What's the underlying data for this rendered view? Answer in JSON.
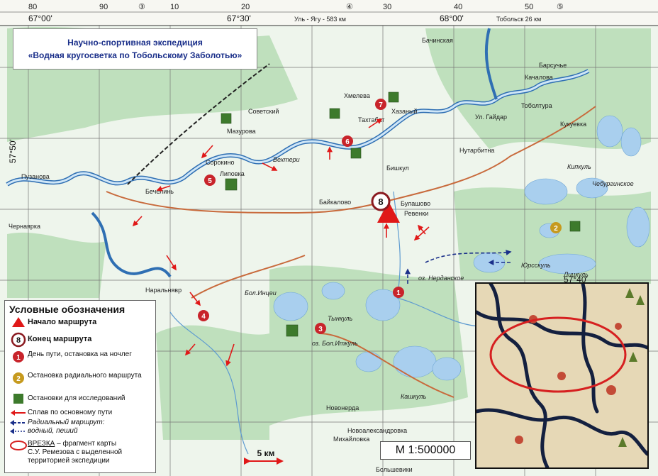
{
  "title": {
    "line1": "Научно-спортивная экспедиция",
    "line2": "«Водная кругосветка по Тобольскому  Заболотью»"
  },
  "top_coords": [
    "67°00'",
    "67°30'",
    "68°00'"
  ],
  "top_grid_numbers": [
    "80",
    "90",
    "③",
    "10",
    "20",
    "④",
    "30",
    "40",
    "50",
    "⑤"
  ],
  "top_road_labels": [
    "Уль - Ягу - 583 км",
    "Тобольск 26 км"
  ],
  "left_coord": "57°50'",
  "right_coord": "57°40'",
  "stage_numbers": [
    "1",
    "2",
    "3",
    "4",
    "5",
    "6",
    "7"
  ],
  "end_stage": "8",
  "place_names": [
    "Хмелева",
    "Хазаный",
    "Тахтабат",
    "Мазурова",
    "Советский",
    "Вехтери",
    "Сорокино",
    "Липовка",
    "Бечелинь",
    "Байкалово",
    "Булашово",
    "Ревенки",
    "Пузанова",
    "Чернаярка",
    "Наральнявр",
    "Новонерда",
    "Новоалександровка",
    "Михайловка",
    "Большевики",
    "Бол.Инцеи",
    "Тынкуль",
    "оз. Бол.Иткуль",
    "Кашкуль",
    "оз. Нерданское",
    "Юрсскуль",
    "Лицкуль",
    "Кипкуль",
    "Чебургинское",
    "Кукуевка",
    "Тоболтура",
    "Нутарбитна",
    "Бишкул",
    "Качалова",
    "Барсучье",
    "Бачинская",
    "Ул. Гайдар"
  ],
  "legend": {
    "title": "Условные обозначения",
    "start": "Начало маршрута",
    "end": "Конец маршрута",
    "end_num": "8",
    "day": "День пути, остановка на ночлег",
    "day_num": "1",
    "radial_stop": "Остановка радиального маршрута",
    "radial_num": "2",
    "research": "Остановки для исследований",
    "rafting": "Сплав по основному пути",
    "radial_route": "Радиальный маршрут:",
    "radial_types": "водный, пеший",
    "inset_word": "ВРЕЗКА",
    "inset_text_1": " – фрагмент карты",
    "inset_text_2": "С.У. Ремезова с выделенной",
    "inset_text_3": "территорией экспедиции"
  },
  "scale": "М 1:500000",
  "scalebar_label": "5 км",
  "colors": {
    "water": "#9ec6e6",
    "lake": "#a9cfee",
    "forest": "#b8dcb8",
    "route": "#e01818",
    "stage": "#c8242b",
    "radial": "#c69a1e",
    "research": "#3d7a2c",
    "radial_route": "#1a2f8a",
    "title_text": "#1a2f8a"
  }
}
